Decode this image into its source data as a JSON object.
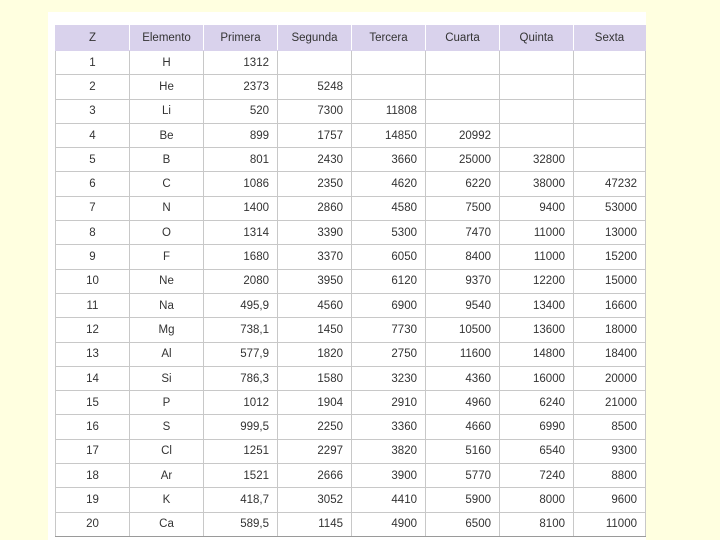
{
  "table": {
    "headers": [
      "Z",
      "Elemento",
      "Primera",
      "Segunda",
      "Tercera",
      "Cuarta",
      "Quinta",
      "Sexta"
    ],
    "rows": [
      [
        "1",
        "H",
        "1312",
        "",
        "",
        "",
        "",
        ""
      ],
      [
        "2",
        "He",
        "2373",
        "5248",
        "",
        "",
        "",
        ""
      ],
      [
        "3",
        "Li",
        "520",
        "7300",
        "11808",
        "",
        "",
        ""
      ],
      [
        "4",
        "Be",
        "899",
        "1757",
        "14850",
        "20992",
        "",
        ""
      ],
      [
        "5",
        "B",
        "801",
        "2430",
        "3660",
        "25000",
        "32800",
        ""
      ],
      [
        "6",
        "C",
        "1086",
        "2350",
        "4620",
        "6220",
        "38000",
        "47232"
      ],
      [
        "7",
        "N",
        "1400",
        "2860",
        "4580",
        "7500",
        "9400",
        "53000"
      ],
      [
        "8",
        "O",
        "1314",
        "3390",
        "5300",
        "7470",
        "11000",
        "13000"
      ],
      [
        "9",
        "F",
        "1680",
        "3370",
        "6050",
        "8400",
        "11000",
        "15200"
      ],
      [
        "10",
        "Ne",
        "2080",
        "3950",
        "6120",
        "9370",
        "12200",
        "15000"
      ],
      [
        "11",
        "Na",
        "495,9",
        "4560",
        "6900",
        "9540",
        "13400",
        "16600"
      ],
      [
        "12",
        "Mg",
        "738,1",
        "1450",
        "7730",
        "10500",
        "13600",
        "18000"
      ],
      [
        "13",
        "Al",
        "577,9",
        "1820",
        "2750",
        "11600",
        "14800",
        "18400"
      ],
      [
        "14",
        "Si",
        "786,3",
        "1580",
        "3230",
        "4360",
        "16000",
        "20000"
      ],
      [
        "15",
        "P",
        "1012",
        "1904",
        "2910",
        "4960",
        "6240",
        "21000"
      ],
      [
        "16",
        "S",
        "999,5",
        "2250",
        "3360",
        "4660",
        "6990",
        "8500"
      ],
      [
        "17",
        "Cl",
        "1251",
        "2297",
        "3820",
        "5160",
        "6540",
        "9300"
      ],
      [
        "18",
        "Ar",
        "1521",
        "2666",
        "3900",
        "5770",
        "7240",
        "8800"
      ],
      [
        "19",
        "K",
        "418,7",
        "3052",
        "4410",
        "5900",
        "8000",
        "9600"
      ],
      [
        "20",
        "Ca",
        "589,5",
        "1145",
        "4900",
        "6500",
        "8100",
        "11000"
      ]
    ]
  },
  "colors": {
    "header_bg": "#d9d2ec",
    "page_bg": "#ffffe0",
    "grid": "#c8c8c8"
  }
}
